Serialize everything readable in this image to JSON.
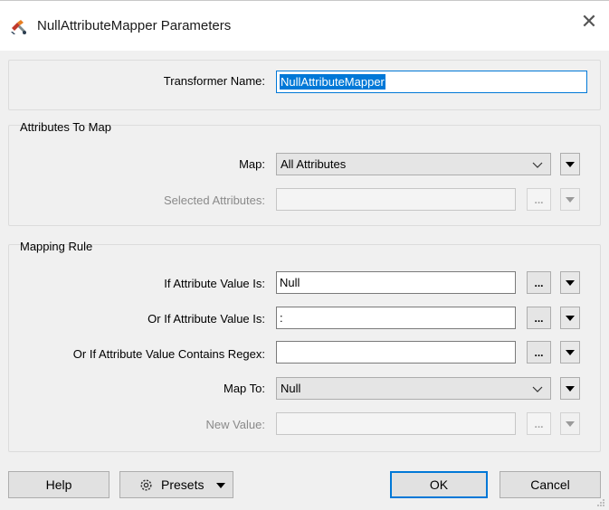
{
  "window": {
    "title": "NullAttributeMapper Parameters",
    "close_glyph": "✕",
    "icon": "transformer-icon"
  },
  "transformer": {
    "label": "Transformer Name:",
    "value": "NullAttributeMapper"
  },
  "attributes_group": {
    "title": "Attributes To Map",
    "map_label": "Map:",
    "map_value": "All Attributes",
    "selected_label": "Selected Attributes:",
    "selected_value": ""
  },
  "mapping_group": {
    "title": "Mapping Rule",
    "if_label": "If Attribute Value Is:",
    "if_value": "Null",
    "or_if_label": "Or If Attribute Value Is:",
    "or_if_value": ":",
    "regex_label": "Or If Attribute Value Contains Regex:",
    "regex_value": "",
    "map_to_label": "Map To:",
    "map_to_value": "Null",
    "new_value_label": "New Value:",
    "new_value_value": ""
  },
  "ellipsis": "...",
  "buttons": {
    "help": "Help",
    "presets": "Presets",
    "ok": "OK",
    "cancel": "Cancel"
  },
  "colors": {
    "accent": "#0078d7",
    "dialog_bg": "#f0f0f0"
  }
}
